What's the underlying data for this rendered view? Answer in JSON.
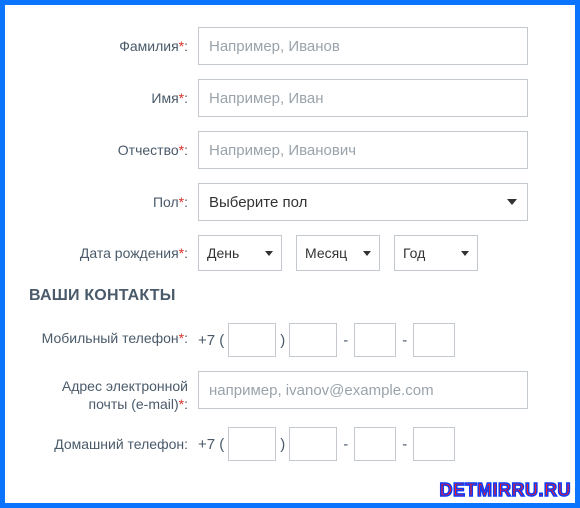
{
  "fields": {
    "surname": {
      "label": "Фамилия",
      "placeholder": "Например, Иванов",
      "required": true
    },
    "name": {
      "label": "Имя",
      "placeholder": "Например, Иван",
      "required": true
    },
    "patronymic": {
      "label": "Отчество",
      "placeholder": "Например, Иванович",
      "required": true
    },
    "gender": {
      "label": "Пол",
      "placeholder": "Выберите пол",
      "required": true
    },
    "birthdate": {
      "label": "Дата рождения",
      "required": true,
      "day": "День",
      "month": "Месяц",
      "year": "Год"
    }
  },
  "contacts": {
    "title": "ВАШИ КОНТАКТЫ",
    "mobile": {
      "label": "Мобильный телефон",
      "required": true,
      "prefix": "+7 (",
      "close": ")",
      "dash": "-"
    },
    "email": {
      "label": "Адрес электронной почты (e-mail)",
      "required": true,
      "placeholder": "например, ivanov@example.com"
    },
    "home": {
      "label": "Домашний телефон:",
      "required": false,
      "prefix": "+7 (",
      "close": ")",
      "dash": "-"
    }
  },
  "required_marker": "*",
  "colon": ":",
  "watermark": "DETMIRRU.RU"
}
